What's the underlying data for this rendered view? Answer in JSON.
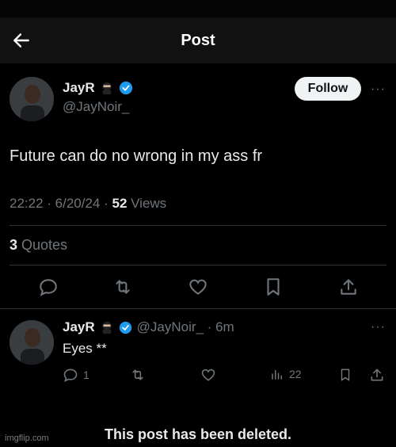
{
  "header": {
    "title": "Post"
  },
  "tweet": {
    "author_name": "JayR",
    "author_handle": "@JayNoir_",
    "follow_label": "Follow",
    "text": "Future can do no wrong in my ass fr",
    "time": "22:22 · 6/20/24 · ",
    "views_count": "52",
    "views_label": " Views",
    "quotes_count": "3",
    "quotes_label": " Quotes"
  },
  "reply": {
    "author_name": "JayR",
    "handle_time": "@JayNoir_ · 6m",
    "text": "Eyes **",
    "reply_count": "1",
    "views_count": "22"
  },
  "footer": {
    "deleted_text": "This post has been deleted."
  },
  "watermark": "imgflip.com",
  "colors": {
    "verified": "#1d9bf0",
    "background": "#000000"
  },
  "icons": [
    "back-arrow-icon",
    "ninja-emoji-icon",
    "verified-badge-icon",
    "more-icon",
    "reply-icon",
    "retweet-icon",
    "like-icon",
    "bookmark-icon",
    "share-icon",
    "views-icon"
  ]
}
